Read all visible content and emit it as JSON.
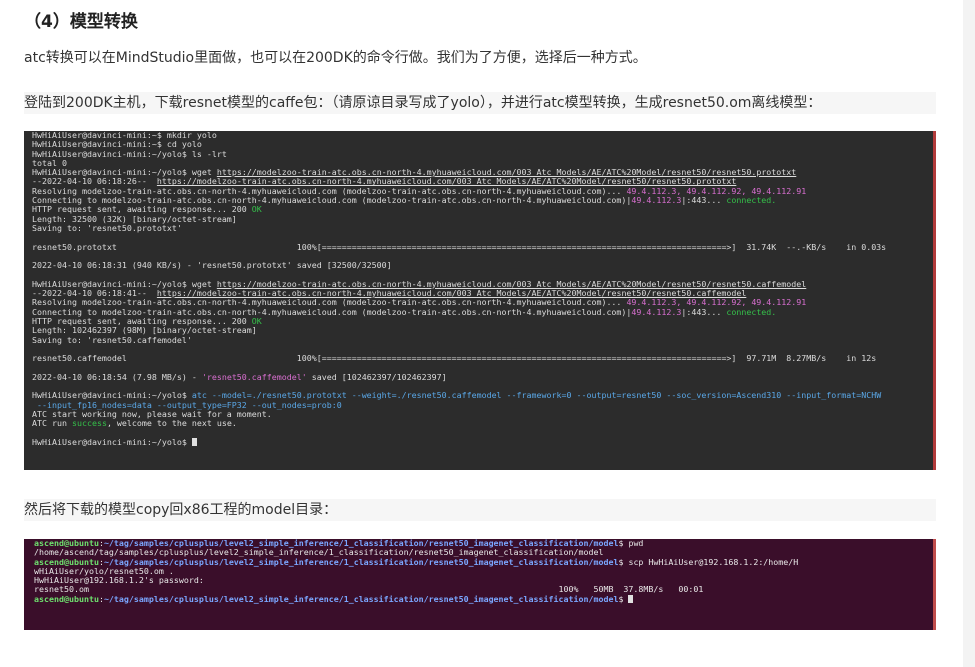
{
  "heading": "（4）模型转换",
  "para1": "atc转换可以在MindStudio里面做，也可以在200DK的命令行做。我们为了方便，选择后一种方式。",
  "para2": "登陆到200DK主机，下载resnet模型的caffe包：（请原谅目录写成了yolo），并进行atc模型转换，生成resnet50.om离线模型：",
  "para3": "然后将下载的模型copy回x86工程的model目录：",
  "terminal1": {
    "prompt": "HwHiAiUser@davinci-mini:~$",
    "prompt_yolo": "HwHiAiUser@davinci-mini:~/yolo$",
    "cmd_mkdir": " mkdir yolo",
    "cmd_cd": " cd yolo",
    "cmd_ls": " ls -lrt",
    "total": "total 0",
    "wget_label": " wget ",
    "url1": "https://modelzoo-train-atc.obs.cn-north-4.myhuaweicloud.com/003_Atc_Models/AE/ATC%20Model/resnet50/resnet50.prototxt",
    "ts1": "--2022-04-10 06:18:26--  ",
    "resolving": "Resolving modelzoo-train-atc.obs.cn-north-4.myhuaweicloud.com (modelzoo-train-atc.obs.cn-north-4.myhuaweicloud.com)... ",
    "ips": "49.4.112.3, 49.4.112.92, 49.4.112.91",
    "connecting": "Connecting to modelzoo-train-atc.obs.cn-north-4.myhuaweicloud.com (modelzoo-train-atc.obs.cn-north-4.myhuaweicloud.com)|",
    "ip_port": "49.4.112.3",
    "port_suffix": "|:443... ",
    "connected": "connected.",
    "http_req": "HTTP request sent, awaiting response... 200 ",
    "ok": "OK",
    "length1": "Length: 32500 (32K) [binary/octet-stream]",
    "saving1": "Saving to: 'resnet50.prototxt'",
    "progress1_file": "resnet50.prototxt",
    "progress1_bar": "100%[=================================================================================>]  31.74K  --.-KB/s    in 0.03s",
    "saved1": "2022-04-10 06:18:31 (940 KB/s) - 'resnet50.prototxt' saved [32500/32500]",
    "url2": "https://modelzoo-train-atc.obs.cn-north-4.myhuaweicloud.com/003_Atc_Models/AE/ATC%20Model/resnet50/resnet50.caffemodel",
    "ts2": "--2022-04-10 06:18:41--  ",
    "length2": "Length: 102462397 (98M) [binary/octet-stream]",
    "saving2": "Saving to: 'resnet50.caffemodel'",
    "progress2_file": "resnet50.caffemodel",
    "progress2_bar": "100%[=================================================================================>]  97.71M  8.27MB/s    in 12s",
    "saved2_prefix": "2022-04-10 06:18:54 (7.98 MB/s) - ",
    "saved2_file": "'resnet50.caffemodel'",
    "saved2_suffix": " saved [102462397/102462397]",
    "atc_cmd": " atc --model=./resnet50.prototxt --weight=./resnet50.caffemodel --framework=0 --output=resnet50 --soc_version=Ascend310 --input_format=NCHW",
    "atc_cmd2": " --input_fp16_nodes=data --output_type=FP32 --out_nodes=prob:0",
    "atc_start": "ATC start working now, please wait for a moment.",
    "atc_run_pre": "ATC run ",
    "atc_success": "success",
    "atc_run_post": ", welcome to the next use."
  },
  "terminal2": {
    "user": "ascend@ubuntu",
    "path": "~/tag/samples/cplusplus/level2_simple_inference/1_classification/resnet50_imagenet_classification/model",
    "cmd_pwd": "$ pwd",
    "pwd_out": "/home/ascend/tag/samples/cplusplus/level2_simple_inference/1_classification/resnet50_imagenet_classification/model",
    "cmd_scp": "$ scp HwHiAiUser@192.168.1.2:/home/H",
    "scp_cont": "wHiAiUser/yolo/resnet50.om .",
    "password": "HwHiAiUser@192.168.1.2's password:",
    "progress_file": "resnet50.om",
    "progress_stats": "100%   50MB  37.8MB/s   00:01",
    "final_prompt_tail": "$ "
  }
}
